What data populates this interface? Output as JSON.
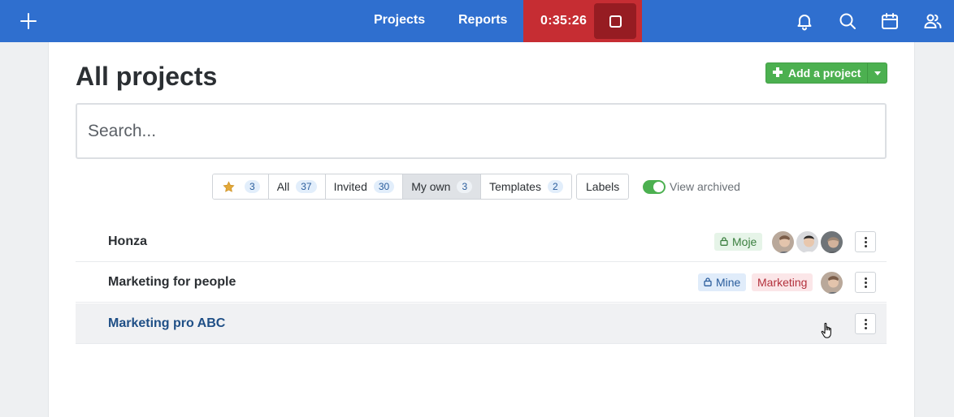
{
  "nav": {
    "projects": "Projects",
    "reports": "Reports",
    "timer": "0:35:26"
  },
  "page": {
    "title": "All projects",
    "add_button": "Add a project",
    "search_placeholder": "Search..."
  },
  "filters": {
    "starred_count": "3",
    "items": [
      {
        "label": "All",
        "count": "37"
      },
      {
        "label": "Invited",
        "count": "30"
      },
      {
        "label": "My own",
        "count": "3"
      },
      {
        "label": "Templates",
        "count": "2"
      }
    ],
    "active": "My own",
    "labels": "Labels",
    "view_archived": "View archived"
  },
  "projects": [
    {
      "name": "Honza",
      "tags": [
        "Moje"
      ],
      "avatars": 3
    },
    {
      "name": "Marketing for people",
      "tags": [
        "Mine",
        "Marketing"
      ],
      "avatars": 1
    },
    {
      "name": "Marketing pro ABC",
      "tags": [],
      "avatars": 0
    }
  ],
  "colors": {
    "topbar": "#2f6fcf",
    "timer_bg": "#c62d33",
    "add_button": "#4cb050",
    "toggle_on": "#4cb050"
  }
}
